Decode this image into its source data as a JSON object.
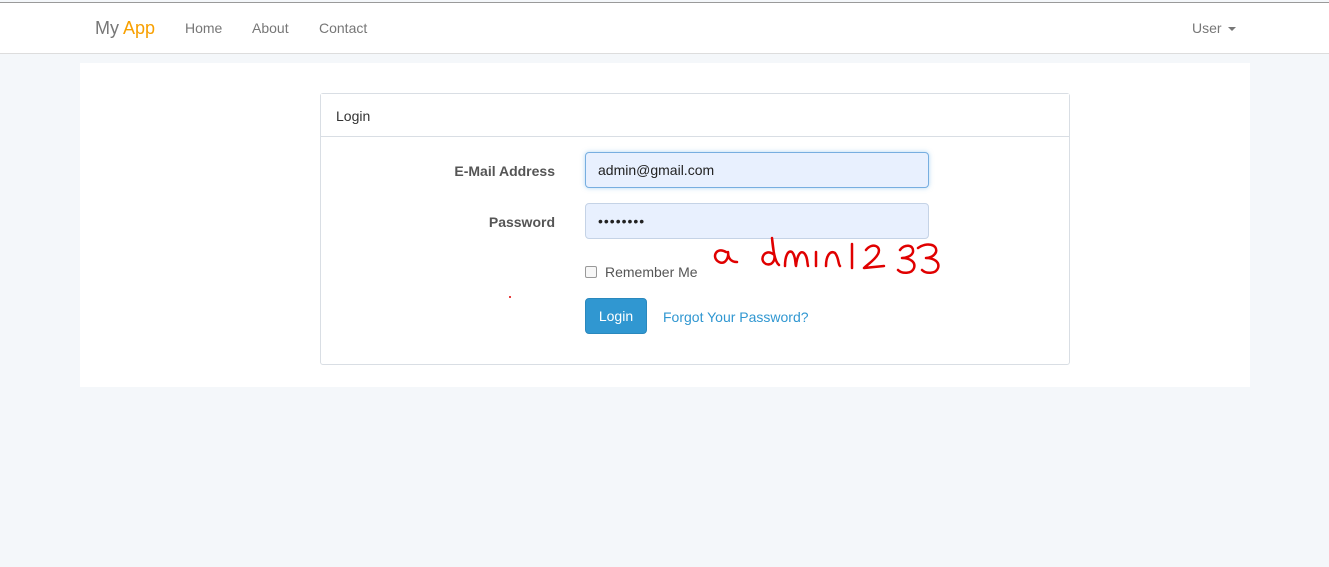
{
  "navbar": {
    "brand_main": "My",
    "brand_accent": "App",
    "links": [
      "Home",
      "About",
      "Contact"
    ],
    "user_label": "User"
  },
  "panel": {
    "heading": "Login"
  },
  "form": {
    "email_label": "E-Mail Address",
    "email_value": "admin@gmail.com",
    "password_label": "Password",
    "password_value": "••••••••",
    "remember_label": "Remember Me",
    "login_button": "Login",
    "forgot_link": "Forgot Your Password?"
  },
  "annotation": {
    "handwritten_text": "admin123",
    "ink_color": "#e00000"
  },
  "colors": {
    "brand_accent": "#f8a000",
    "primary": "#3097d1",
    "autofill_bg": "#e8f0fe"
  }
}
